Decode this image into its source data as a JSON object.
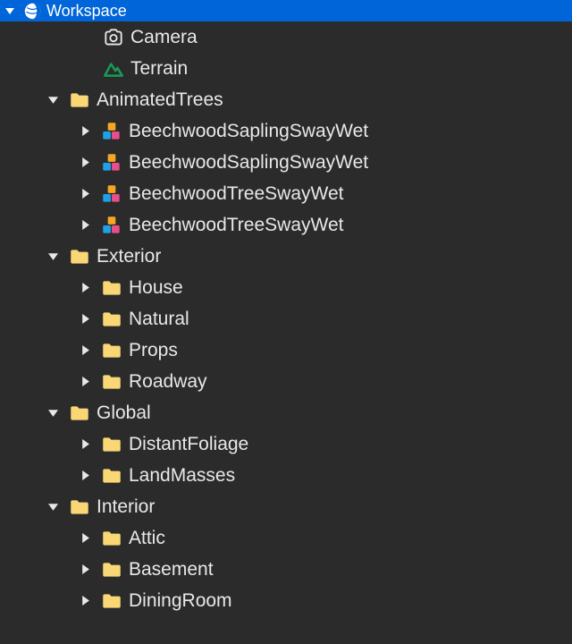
{
  "root": {
    "label": "Workspace"
  },
  "items": [
    {
      "depth": 1,
      "arrow": "none",
      "icon": "camera",
      "label": "Camera"
    },
    {
      "depth": 1,
      "arrow": "none",
      "icon": "terrain",
      "label": "Terrain"
    },
    {
      "depth": 2,
      "arrow": "expanded",
      "icon": "folder",
      "label": "AnimatedTrees"
    },
    {
      "depth": 3,
      "arrow": "collapsed",
      "icon": "model",
      "label": "BeechwoodSaplingSwayWet"
    },
    {
      "depth": 3,
      "arrow": "collapsed",
      "icon": "model",
      "label": "BeechwoodSaplingSwayWet"
    },
    {
      "depth": 3,
      "arrow": "collapsed",
      "icon": "model",
      "label": "BeechwoodTreeSwayWet"
    },
    {
      "depth": 3,
      "arrow": "collapsed",
      "icon": "model",
      "label": "BeechwoodTreeSwayWet"
    },
    {
      "depth": 2,
      "arrow": "expanded",
      "icon": "folder",
      "label": "Exterior"
    },
    {
      "depth": 3,
      "arrow": "collapsed",
      "icon": "folder",
      "label": "House"
    },
    {
      "depth": 3,
      "arrow": "collapsed",
      "icon": "folder",
      "label": "Natural"
    },
    {
      "depth": 3,
      "arrow": "collapsed",
      "icon": "folder",
      "label": "Props"
    },
    {
      "depth": 3,
      "arrow": "collapsed",
      "icon": "folder",
      "label": "Roadway"
    },
    {
      "depth": 2,
      "arrow": "expanded",
      "icon": "folder",
      "label": "Global"
    },
    {
      "depth": 3,
      "arrow": "collapsed",
      "icon": "folder",
      "label": "DistantFoliage"
    },
    {
      "depth": 3,
      "arrow": "collapsed",
      "icon": "folder",
      "label": "LandMasses"
    },
    {
      "depth": 2,
      "arrow": "expanded",
      "icon": "folder",
      "label": "Interior"
    },
    {
      "depth": 3,
      "arrow": "collapsed",
      "icon": "folder",
      "label": "Attic"
    },
    {
      "depth": 3,
      "arrow": "collapsed",
      "icon": "folder",
      "label": "Basement"
    },
    {
      "depth": 3,
      "arrow": "collapsed",
      "icon": "folder",
      "label": "DiningRoom"
    }
  ],
  "colors": {
    "selection": "#0065d8",
    "folder": "#f9d775",
    "terrain": "#169c56",
    "model_orange": "#f5a623",
    "model_blue": "#1fa0ea",
    "model_pink": "#e84e8a"
  }
}
